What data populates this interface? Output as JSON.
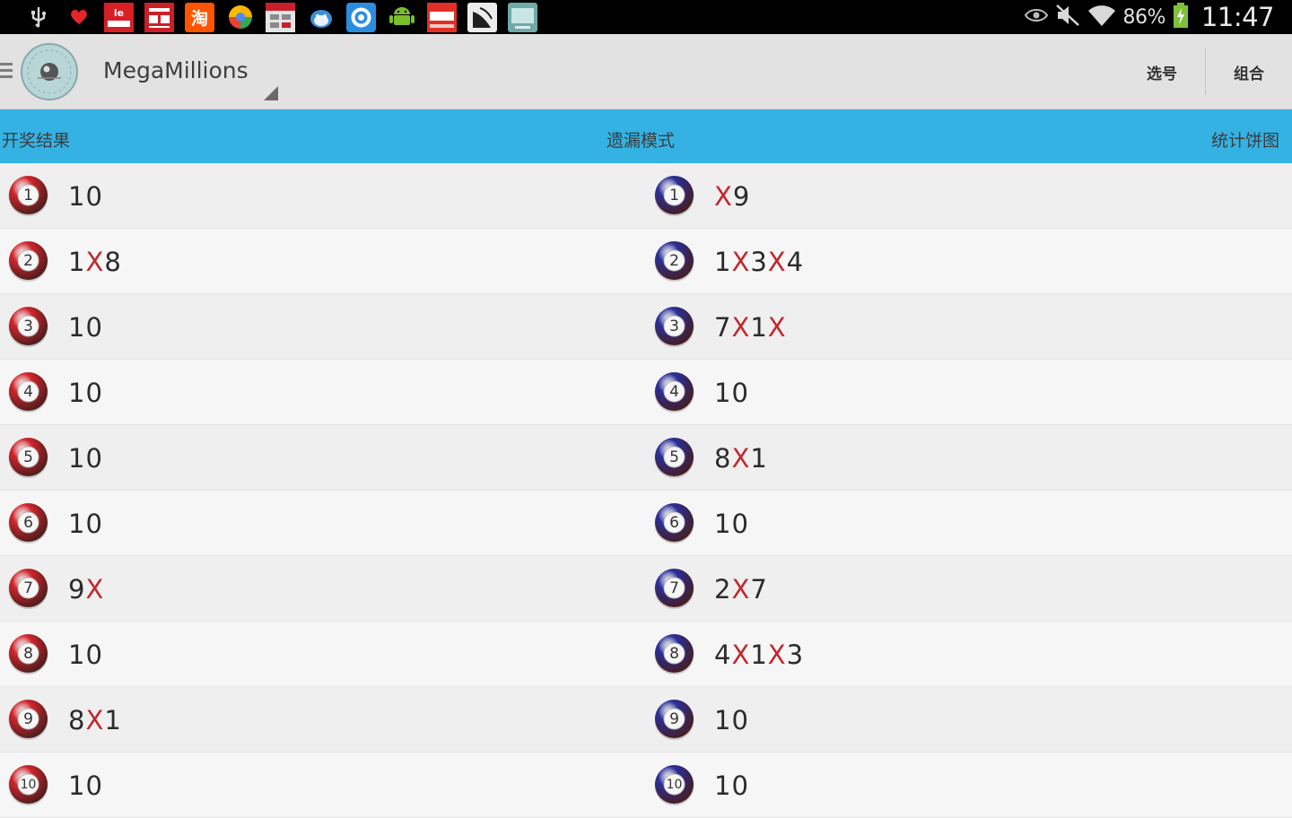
{
  "status_bar": {
    "notification_icons": [
      "usb-icon",
      "heart-icon",
      "letv-icon",
      "news-icon",
      "taobao-icon",
      "browser-icon",
      "calendar-icon",
      "bird-icon",
      "qq-browser-icon",
      "android-icon",
      "video-icon",
      "satellite-icon",
      "tv-icon"
    ],
    "battery_percent": "86%",
    "time": "11:47"
  },
  "action_bar": {
    "title": "MegaMillions",
    "select_label": "选号",
    "combo_label": "组合"
  },
  "tabs": {
    "results": "开奖结果",
    "omission": "遗漏模式",
    "stats": "统计饼图"
  },
  "colors": {
    "tab_bar": "#34b2e4",
    "red_ball": "#d2262c",
    "blue_ball": "#2a2f9a",
    "x_mark": "#c2272d"
  },
  "rows": [
    {
      "left_num": "1",
      "left": "10",
      "right_num": "1",
      "right": "X9"
    },
    {
      "left_num": "2",
      "left": "1X8",
      "right_num": "2",
      "right": "1X3X4"
    },
    {
      "left_num": "3",
      "left": "10",
      "right_num": "3",
      "right": "7X1X"
    },
    {
      "left_num": "4",
      "left": "10",
      "right_num": "4",
      "right": "10"
    },
    {
      "left_num": "5",
      "left": "10",
      "right_num": "5",
      "right": "8X1"
    },
    {
      "left_num": "6",
      "left": "10",
      "right_num": "6",
      "right": "10"
    },
    {
      "left_num": "7",
      "left": "9X",
      "right_num": "7",
      "right": "2X7"
    },
    {
      "left_num": "8",
      "left": "10",
      "right_num": "8",
      "right": "4X1X3"
    },
    {
      "left_num": "9",
      "left": "8X1",
      "right_num": "9",
      "right": "10"
    },
    {
      "left_num": "10",
      "left": "10",
      "right_num": "10",
      "right": "10"
    }
  ]
}
